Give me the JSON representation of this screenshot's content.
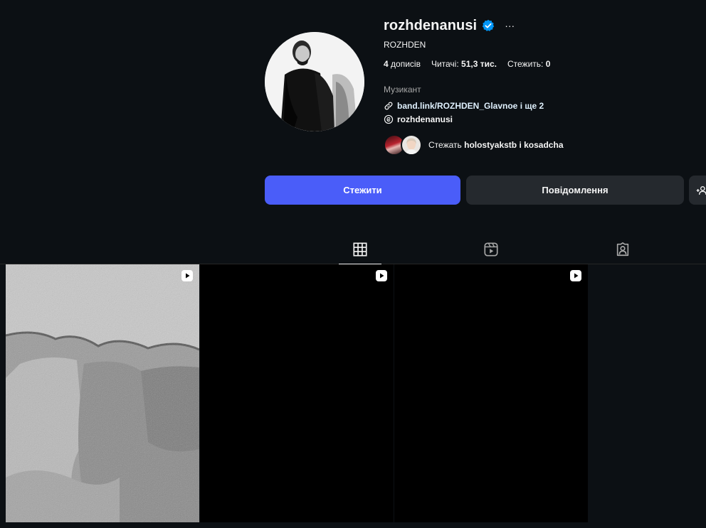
{
  "profile": {
    "username": "rozhdenanusi",
    "full_name": "ROZHDEN",
    "more_label": "···",
    "posts_count": "4",
    "posts_label": "дописів",
    "followers_label": "Читачі:",
    "followers_count": "51,3 тис.",
    "following_label": "Стежить:",
    "following_count": "0",
    "category": "Музикант",
    "link_text": "band.link/ROZHDEN_Glavnoe і ще 2",
    "threads_handle": "rozhdenanusi",
    "followed_by_prefix": "Стежать",
    "followed_by_names": "holostyakstb і kosadcha"
  },
  "actions": {
    "follow_label": "Стежити",
    "message_label": "Повідомлення"
  },
  "tabs": [
    {
      "name": "posts",
      "icon": "grid-icon",
      "active": true
    },
    {
      "name": "reels",
      "icon": "reels-icon",
      "active": false
    },
    {
      "name": "tagged",
      "icon": "tagged-icon",
      "active": false
    }
  ],
  "posts": [
    {
      "type": "reel",
      "icon": "reel-badge-icon"
    },
    {
      "type": "reel",
      "icon": "reel-badge-icon"
    },
    {
      "type": "reel",
      "icon": "reel-badge-icon"
    }
  ],
  "colors": {
    "background": "#0c1014",
    "accent": "#4a5df9",
    "verified": "#0095f6",
    "secondary_button": "#25292e"
  }
}
